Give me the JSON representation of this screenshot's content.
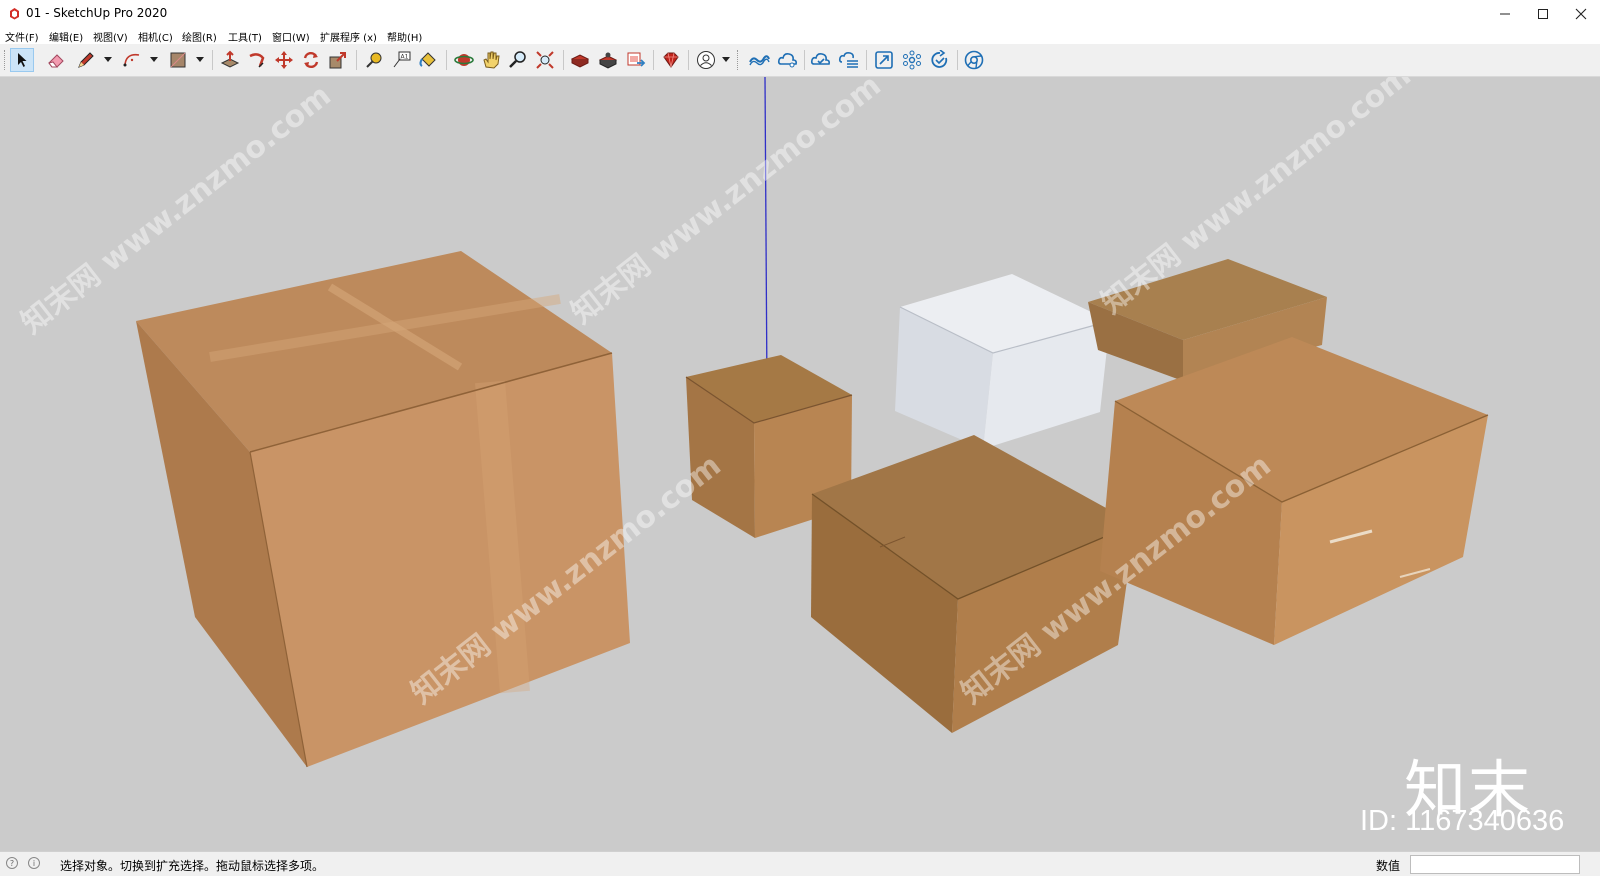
{
  "window": {
    "title": "01 - SketchUp Pro 2020"
  },
  "menu": [
    "文件(F)",
    "编辑(E)",
    "视图(V)",
    "相机(C)",
    "绘图(R)",
    "工具(T)",
    "窗口(W)",
    "扩展程序 (x)",
    "帮助(H)"
  ],
  "toolbar": {
    "tools": [
      "select-tool",
      "eraser-tool",
      "line-tool",
      "arc-tool",
      "rectangle-tool",
      "push-pull-tool",
      "follow-me-tool",
      "move-tool",
      "rotate-tool",
      "scale-tool",
      "tape-measure-tool",
      "text-tool",
      "paint-bucket-tool",
      "orbit-tool",
      "pan-tool",
      "zoom-tool",
      "zoom-extents-tool",
      "3d-warehouse-tool",
      "extension-warehouse-tool",
      "layout-send-tool",
      "ruby-console-tool",
      "account-tool",
      "trimble-connect-tool",
      "cloud-share-tool",
      "cloud-sync-tool",
      "cloud-list-tool",
      "extent-tool",
      "network-tool",
      "refresh-tool",
      "chrome-tool"
    ],
    "active_tool": "select-tool"
  },
  "viewport": {
    "background": "#cbcbcb",
    "blue_axis_color": "#2f2fc8",
    "objects": [
      "large-cardboard-box",
      "small-cardboard-box",
      "white-box",
      "flat-cardboard-box",
      "open-top-cardboard-box",
      "long-cardboard-box"
    ]
  },
  "watermark": {
    "text": "知末网 www.znzmo.com",
    "logo": "知末",
    "id": "ID: 1167340636"
  },
  "status": {
    "hint": "选择对象。切换到扩充选择。拖动鼠标选择多项。",
    "measurements_label": "数值",
    "measurements_value": ""
  }
}
